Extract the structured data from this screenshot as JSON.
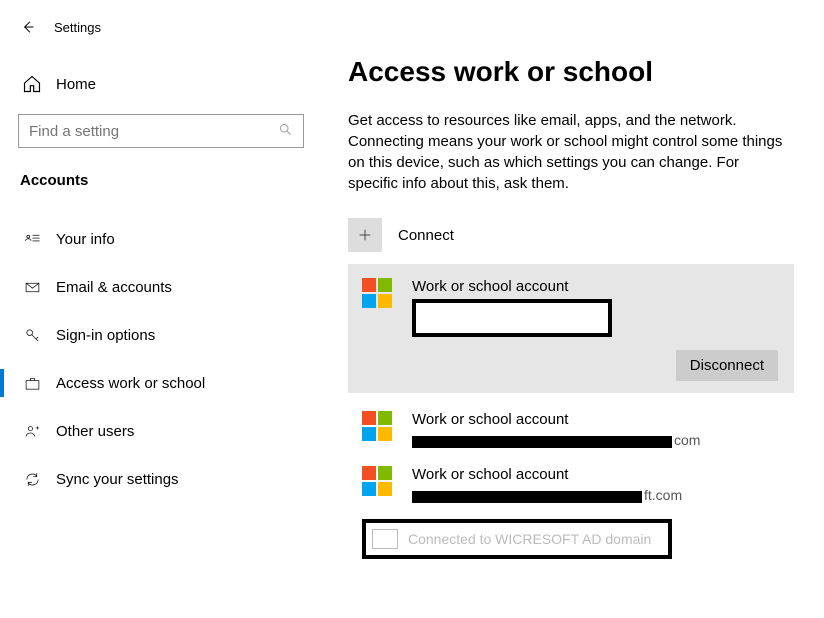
{
  "appTitle": "Settings",
  "homeLabel": "Home",
  "searchPlaceholder": "Find a setting",
  "sectionTitle": "Accounts",
  "nav": {
    "yourInfo": "Your info",
    "emailAccounts": "Email & accounts",
    "signInOptions": "Sign-in options",
    "accessWorkSchool": "Access work or school",
    "otherUsers": "Other users",
    "syncSettings": "Sync your settings"
  },
  "pageTitle": "Access work or school",
  "description": "Get access to resources like email, apps, and the network. Connecting means your work or school might control some things on this device, such as which settings you can change. For specific info about this, ask them.",
  "connectLabel": "Connect",
  "disconnectLabel": "Disconnect",
  "accounts": {
    "a1": {
      "title": "Work or school account"
    },
    "a2": {
      "title": "Work or school account",
      "suffix": "com"
    },
    "a3": {
      "title": "Work or school account",
      "suffix": "ft.com"
    }
  },
  "domainGhostText": "Connected to WICRESOFT AD domain"
}
